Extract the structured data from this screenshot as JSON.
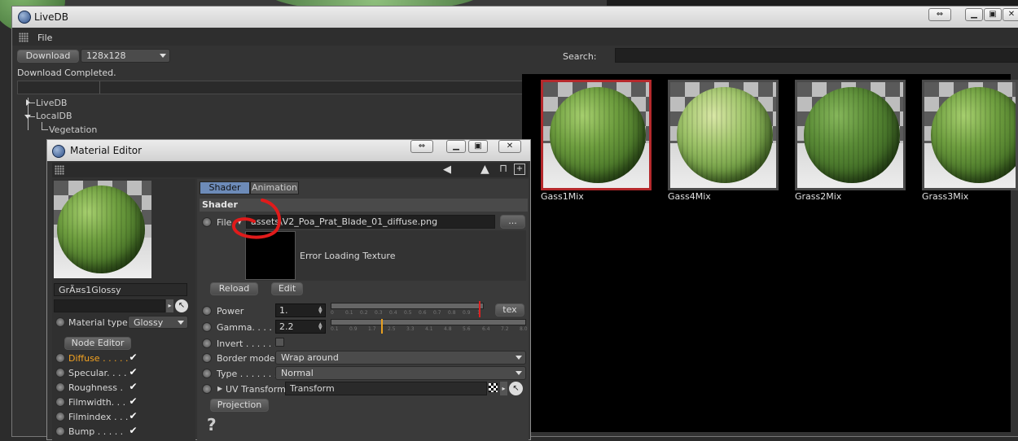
{
  "livedb": {
    "title": "LiveDB",
    "menu": [
      "File"
    ],
    "download_button": "Download",
    "size_select": "128x128",
    "search_label": "Search:",
    "search_value": "",
    "status": "Download Completed.",
    "tree": [
      "LiveDB",
      "LocalDB",
      "Vegetation"
    ]
  },
  "thumbnails": [
    {
      "label": "Gass1Mix",
      "selected": true
    },
    {
      "label": "Gass4Mix",
      "selected": false
    },
    {
      "label": "Grass2Mix",
      "selected": false
    },
    {
      "label": "Grass3Mix",
      "selected": false
    }
  ],
  "material_editor": {
    "title": "Material Editor",
    "material_name": "GrÃ¤s1Glossy",
    "material_type_label": "Material type",
    "material_type_value": "Glossy",
    "node_editor_button": "Node Editor",
    "channels": [
      {
        "label": "Diffuse . . . . .",
        "checked": true,
        "active": true
      },
      {
        "label": "Specular. . . .",
        "checked": true,
        "active": false
      },
      {
        "label": "Roughness  .",
        "checked": true,
        "active": false
      },
      {
        "label": "Filmwidth. . .",
        "checked": true,
        "active": false
      },
      {
        "label": "Filmindex . . .",
        "checked": true,
        "active": false
      },
      {
        "label": "Bump . . . . .",
        "checked": true,
        "active": false
      }
    ],
    "tabs": [
      "Shader",
      "Animation"
    ],
    "section_title": "Shader",
    "file_label": "File",
    "file_value": "assets\\V2_Poa_Prat_Blade_01_diffuse.png",
    "browse_button": "...",
    "texture_error": "Error Loading Texture",
    "reload_button": "Reload",
    "edit_button": "Edit",
    "power_label": "Power",
    "power_value": "1.",
    "power_ticks": [
      "0",
      "0.1",
      "0.2",
      "0.3",
      "0.4",
      "0.5",
      "0.6",
      "0.7",
      "0.8",
      "0.9",
      "1"
    ],
    "tex_button": "tex",
    "gamma_label": "Gamma. . . . .",
    "gamma_value": "2.2",
    "gamma_ticks": [
      "0.1",
      "0.9",
      "1.7",
      "2.5",
      "3.3",
      "4.1",
      "4.8",
      "5.6",
      "6.4",
      "7.2",
      "8.0"
    ],
    "invert_label": "Invert  . . . . . .",
    "border_mode_label": "Border mode",
    "border_mode_value": "Wrap around",
    "type_label": "Type  . . . . . . .",
    "type_value": "Normal",
    "uv_label": "UV Transform",
    "uv_value": "Transform",
    "projection_button": "Projection",
    "help": "?"
  },
  "colors": {
    "selected_thumb": "#b5292c",
    "active_tab": "#6d8bb8",
    "diffuse_label": "#f4a321",
    "annotation": "#e01b1b"
  }
}
